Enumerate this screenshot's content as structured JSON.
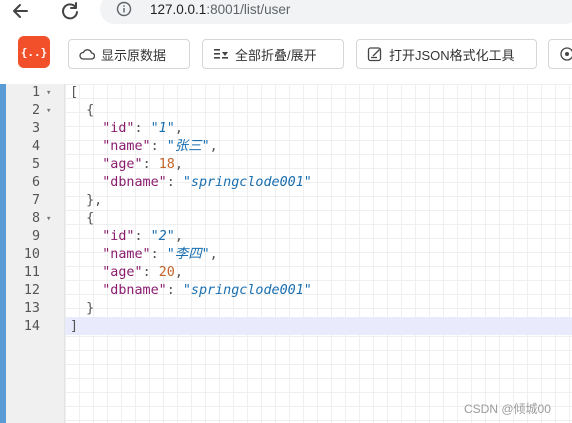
{
  "browser": {
    "url_host": "127.0.0.1",
    "url_rest": ":8001/list/user"
  },
  "toolbar": {
    "logo_text": "{..}",
    "raw_label": "显示原数据",
    "fold_label": "全部折叠/展开",
    "tool_label": "打开JSON格式化工具"
  },
  "editor": {
    "lines": [
      {
        "num": "1",
        "fold": "▾"
      },
      {
        "num": "2",
        "fold": "▾"
      },
      {
        "num": "3",
        "fold": ""
      },
      {
        "num": "4",
        "fold": ""
      },
      {
        "num": "5",
        "fold": ""
      },
      {
        "num": "6",
        "fold": ""
      },
      {
        "num": "7",
        "fold": ""
      },
      {
        "num": "8",
        "fold": "▾"
      },
      {
        "num": "9",
        "fold": ""
      },
      {
        "num": "10",
        "fold": ""
      },
      {
        "num": "11",
        "fold": ""
      },
      {
        "num": "12",
        "fold": ""
      },
      {
        "num": "13",
        "fold": ""
      },
      {
        "num": "14",
        "fold": ""
      }
    ],
    "users": [
      {
        "id_key": "\"id\"",
        "id_val": "\"1\"",
        "name_key": "\"name\"",
        "name_val": "\"张三\"",
        "age_key": "\"age\"",
        "age_val": "18",
        "db_key": "\"dbname\"",
        "db_val": "\"springclode001\""
      },
      {
        "id_key": "\"id\"",
        "id_val": "\"2\"",
        "name_key": "\"name\"",
        "name_val": "\"李四\"",
        "age_key": "\"age\"",
        "age_val": "20",
        "db_key": "\"dbname\"",
        "db_val": "\"springclode001\""
      }
    ]
  },
  "watermark": "CSDN @倾城00"
}
